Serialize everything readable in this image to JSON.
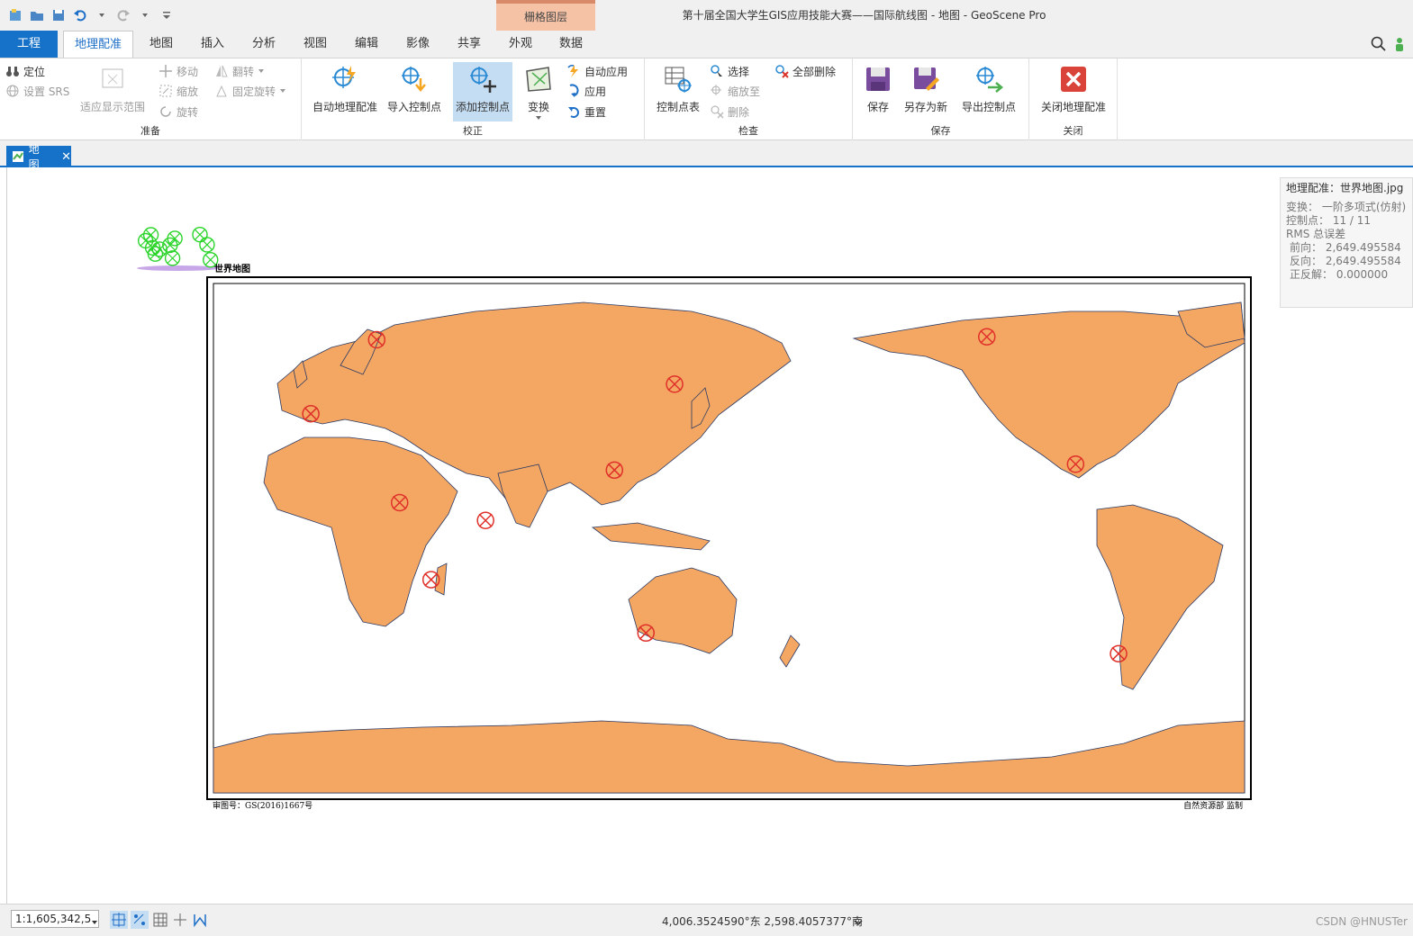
{
  "window": {
    "title": "第十届全国大学生GIS应用技能大赛——国际航线图 - 地图 - GeoScene Pro"
  },
  "context_group": {
    "label": "栅格图层"
  },
  "tabs": [
    {
      "label": "工程"
    },
    {
      "label": "地理配准"
    },
    {
      "label": "地图"
    },
    {
      "label": "插入"
    },
    {
      "label": "分析"
    },
    {
      "label": "视图"
    },
    {
      "label": "编辑"
    },
    {
      "label": "影像"
    },
    {
      "label": "共享"
    },
    {
      "label": "外观"
    },
    {
      "label": "数据"
    }
  ],
  "ribbon": {
    "prepare": {
      "label": "准备",
      "locate": "定位",
      "set_srs": "设置 SRS",
      "fit_display": "适应显示范围",
      "move": "移动",
      "scale": "缩放",
      "rotate": "旋转",
      "flip": "翻转",
      "fixed_rotate": "固定旋转"
    },
    "correct": {
      "label": "校正",
      "auto_georef": "自动地理配准",
      "import_cp": "导入控制点",
      "add_cp": "添加控制点",
      "transform": "变换",
      "auto_apply": "自动应用",
      "apply": "应用",
      "reset": "重置"
    },
    "inspect": {
      "label": "检查",
      "cp_table": "控制点表",
      "select": "选择",
      "zoom_to": "缩放至",
      "delete": "删除",
      "delete_all": "全部删除"
    },
    "save": {
      "label": "保存",
      "save": "保存",
      "save_as": "另存为新",
      "export_cp": "导出控制点"
    },
    "close": {
      "label": "关闭",
      "close_georef": "关闭地理配准"
    }
  },
  "view_tab": {
    "label": "地图"
  },
  "map": {
    "title": "世界地图",
    "approval": "审图号：GS(2016)1667号",
    "credit": "自然资源部 监制",
    "control_points": [
      {
        "lon": 37,
        "lat": 66
      },
      {
        "lon": 141,
        "lat": 51
      },
      {
        "lon": 14,
        "lat": 41
      },
      {
        "lon": 120,
        "lat": 22
      },
      {
        "lon": 45,
        "lat": 11
      },
      {
        "lon": 75,
        "lat": 5
      },
      {
        "lon": 56,
        "lat": -15
      },
      {
        "lon": 131,
        "lat": -33
      },
      {
        "lon": 250,
        "lat": 67
      },
      {
        "lon": 281,
        "lat": 24
      },
      {
        "lon": 296,
        "lat": -40
      }
    ]
  },
  "georef_info": {
    "title": "地理配准：世界地图.jpg",
    "transform": "变换：   一阶多项式(仿射)",
    "control_points": "控制点：  11 / 11",
    "rms_label": "RMS 总误差",
    "forward": "前向：   2,649.495584",
    "inverse": "反向：   2,649.495584",
    "forward_inverse": "正反解：  0.000000"
  },
  "status": {
    "scale": "1:1,605,342,5",
    "coordinates": "4,006.3524590°东  2,598.4057377°南",
    "watermark": "CSDN @HNUSTer"
  }
}
